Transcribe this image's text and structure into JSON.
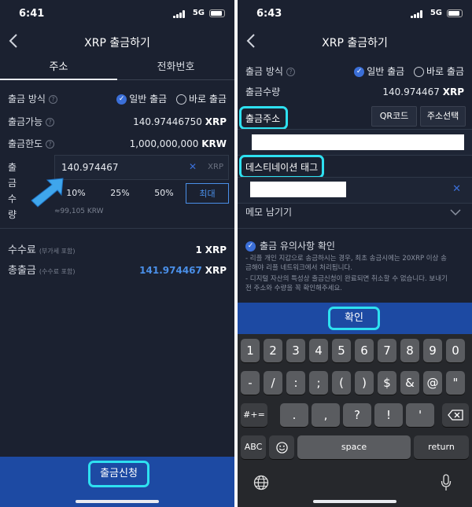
{
  "left": {
    "time": "6:41",
    "network": "5G",
    "title": "XRP 출금하기",
    "tabs": [
      "주소",
      "전화번호"
    ],
    "withdraw_method_label": "출금 방식",
    "option_normal": "일반 출금",
    "option_instant": "바로 출금",
    "available_label": "출금가능",
    "available_value": "140.97446750",
    "available_unit": "XRP",
    "limit_label": "출금한도",
    "limit_value": "1,000,000,000",
    "limit_unit": "KRW",
    "amount_label": "출금수량",
    "amount_value": "140.974467",
    "amount_unit_hint": "XRP",
    "percent_buttons": [
      "10%",
      "25%",
      "50%",
      "최대"
    ],
    "krw_estimate": "≈99,105 KRW",
    "fee_label": "수수료",
    "fee_note": "(부가세 포함)",
    "fee_value": "1",
    "fee_unit": "XRP",
    "total_label": "총출금",
    "total_note": "(수수료 포함)",
    "total_value": "141.974467",
    "total_unit": "XRP",
    "submit_label": "출금신청"
  },
  "right": {
    "time": "6:43",
    "network": "5G",
    "title": "XRP 출금하기",
    "withdraw_method_label": "출금 방식",
    "option_normal": "일반 출금",
    "option_instant": "바로 출금",
    "amount_label": "출금수량",
    "amount_value": "140.974467",
    "amount_unit": "XRP",
    "address_label": "출금주소",
    "qr_button": "QR코드",
    "address_select_button": "주소선택",
    "tag_label": "데스티네이션 태그",
    "memo_label": "메모 남기기",
    "notice_title": "출금 유의사항 확인",
    "notice_lines": [
      "- 리플 개인 지갑으로 송금하시는 경우, 최초 송금시에는 20XRP 이상 송",
      "  금해야 리플 네트워크에서 처리됩니다.",
      "- 디지털 자산의 특성상 출금신청이 완료되면 취소할 수 없습니다. 보내기",
      "  전 주소와 수량을 꼭 확인해주세요."
    ],
    "confirm_label": "확인",
    "keyboard": {
      "row1": [
        "1",
        "2",
        "3",
        "4",
        "5",
        "6",
        "7",
        "8",
        "9",
        "0"
      ],
      "row2": [
        "-",
        "/",
        ":",
        ";",
        "(",
        ")",
        "$",
        "&",
        "@",
        "\""
      ],
      "row3_left": "#+=",
      "row3": [
        ".",
        ",",
        "?",
        "!",
        "'"
      ],
      "abc": "ABC",
      "space": "space",
      "return": "return"
    }
  }
}
